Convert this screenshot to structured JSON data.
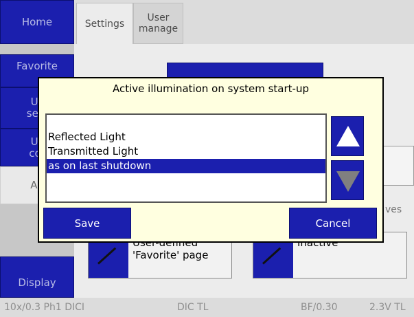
{
  "sidebar": {
    "home": "Home",
    "favorite": "Favorite",
    "user_select": "Us\nsele",
    "user_con": "Us\ncor",
    "advanced": "Ad",
    "display": "Display"
  },
  "tabs": {
    "settings": "Settings",
    "user_manage": "User\nmanage"
  },
  "background": {
    "side_text": "ves",
    "card1_label": "User-defined\n'Favorite' page",
    "card2_label": "Inactive"
  },
  "dialog": {
    "title": "Active illumination on system start-up",
    "options": [
      "Reflected Light",
      "Transmitted Light",
      "as on last shutdown"
    ],
    "selected_index": 2,
    "save": "Save",
    "cancel": "Cancel",
    "up_icon": "triangle-up-icon",
    "down_icon": "triangle-down-icon"
  },
  "status": {
    "objective": "10x/0.3 Ph1 DICI",
    "contrast": "DIC TL",
    "field": "BF/0.30",
    "voltage": "2.3V TL"
  },
  "colors": {
    "accent": "#1b1fae",
    "dialog_bg": "#ffffe0",
    "selection": "#1b1fae"
  }
}
